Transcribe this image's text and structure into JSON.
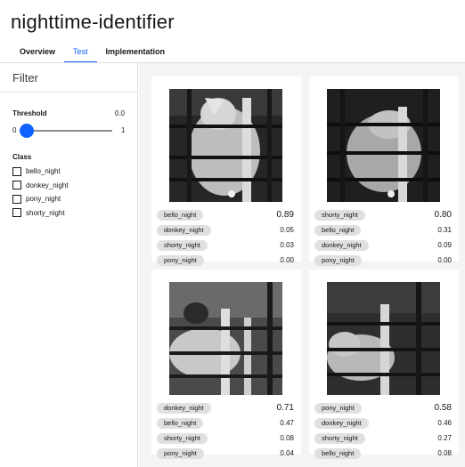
{
  "app": {
    "title": "nighttime-identifier"
  },
  "tabs": [
    {
      "label": "Overview",
      "active": false
    },
    {
      "label": "Test",
      "active": true
    },
    {
      "label": "Implementation",
      "active": false
    }
  ],
  "sidebar": {
    "filter_title": "Filter",
    "threshold": {
      "label": "Threshold",
      "value": "0.0",
      "min": "0",
      "max": "1",
      "level": 0.0
    },
    "class_filter": {
      "label": "Class",
      "options": [
        {
          "label": "bello_night",
          "checked": false
        },
        {
          "label": "donkey_night",
          "checked": false
        },
        {
          "label": "pony_night",
          "checked": false
        },
        {
          "label": "shorty_night",
          "checked": false
        }
      ]
    }
  },
  "results": [
    {
      "image_icon": "horse-night-photo",
      "scores": [
        {
          "label": "bello_night",
          "value": "0.89"
        },
        {
          "label": "donkey_night",
          "value": "0.05"
        },
        {
          "label": "shorty_night",
          "value": "0.03"
        },
        {
          "label": "pony_night",
          "value": "0.00"
        }
      ]
    },
    {
      "image_icon": "horse-night-photo",
      "scores": [
        {
          "label": "shorty_night",
          "value": "0.80"
        },
        {
          "label": "bello_night",
          "value": "0.31"
        },
        {
          "label": "donkey_night",
          "value": "0.09"
        },
        {
          "label": "pony_night",
          "value": "0.00"
        }
      ]
    },
    {
      "image_icon": "horse-night-photo",
      "scores": [
        {
          "label": "donkey_night",
          "value": "0.71"
        },
        {
          "label": "bello_night",
          "value": "0.47"
        },
        {
          "label": "shorty_night",
          "value": "0.08"
        },
        {
          "label": "pony_night",
          "value": "0.04"
        }
      ]
    },
    {
      "image_icon": "horse-night-photo",
      "scores": [
        {
          "label": "pony_night",
          "value": "0.58"
        },
        {
          "label": "donkey_night",
          "value": "0.46"
        },
        {
          "label": "shorty_night",
          "value": "0.27"
        },
        {
          "label": "bello_night",
          "value": "0.08"
        }
      ]
    }
  ],
  "colors": {
    "accent": "#0f62fe",
    "tag_bg": "#e0e0e0",
    "main_bg": "#f4f4f4"
  }
}
